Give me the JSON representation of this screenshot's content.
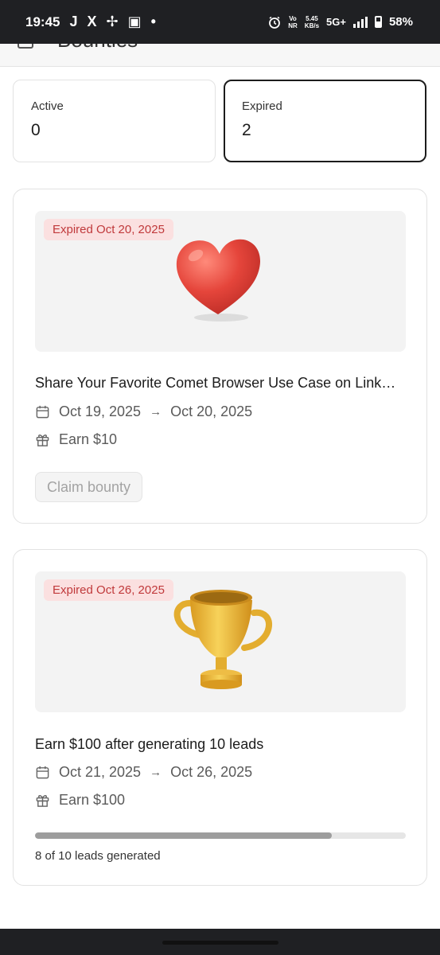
{
  "status_bar": {
    "time": "19:45",
    "left_icons": [
      "J",
      "X",
      "✢",
      "▣",
      "•"
    ],
    "volte_top": "Vo",
    "volte_bottom": "NR",
    "speed_value": "5.45",
    "speed_unit": "KB/s",
    "network": "5G+",
    "battery": "58%"
  },
  "header": {
    "title": "Bounties"
  },
  "stats": {
    "active": {
      "label": "Active",
      "value": "0"
    },
    "expired": {
      "label": "Expired",
      "value": "2"
    }
  },
  "bounties": [
    {
      "badge": "Expired Oct 20, 2025",
      "image_icon": "heart",
      "title": "Share Your Favorite Comet Browser Use Case on Link…",
      "date_start": "Oct 19, 2025",
      "arrow": "→",
      "date_end": "Oct 20, 2025",
      "reward": "Earn $10",
      "button": "Claim bounty"
    },
    {
      "badge": "Expired Oct 26, 2025",
      "image_icon": "trophy",
      "title": "Earn $100 after generating 10 leads",
      "date_start": "Oct 21, 2025",
      "arrow": "→",
      "date_end": "Oct 26, 2025",
      "reward": "Earn $100",
      "progress": 0.8,
      "progress_label": "8 of 10 leads generated"
    }
  ],
  "colors": {
    "badge_bg": "#fbe0e0",
    "badge_text": "#c0393b",
    "heart": "#e5453b",
    "trophy": "#f0bd3c"
  }
}
